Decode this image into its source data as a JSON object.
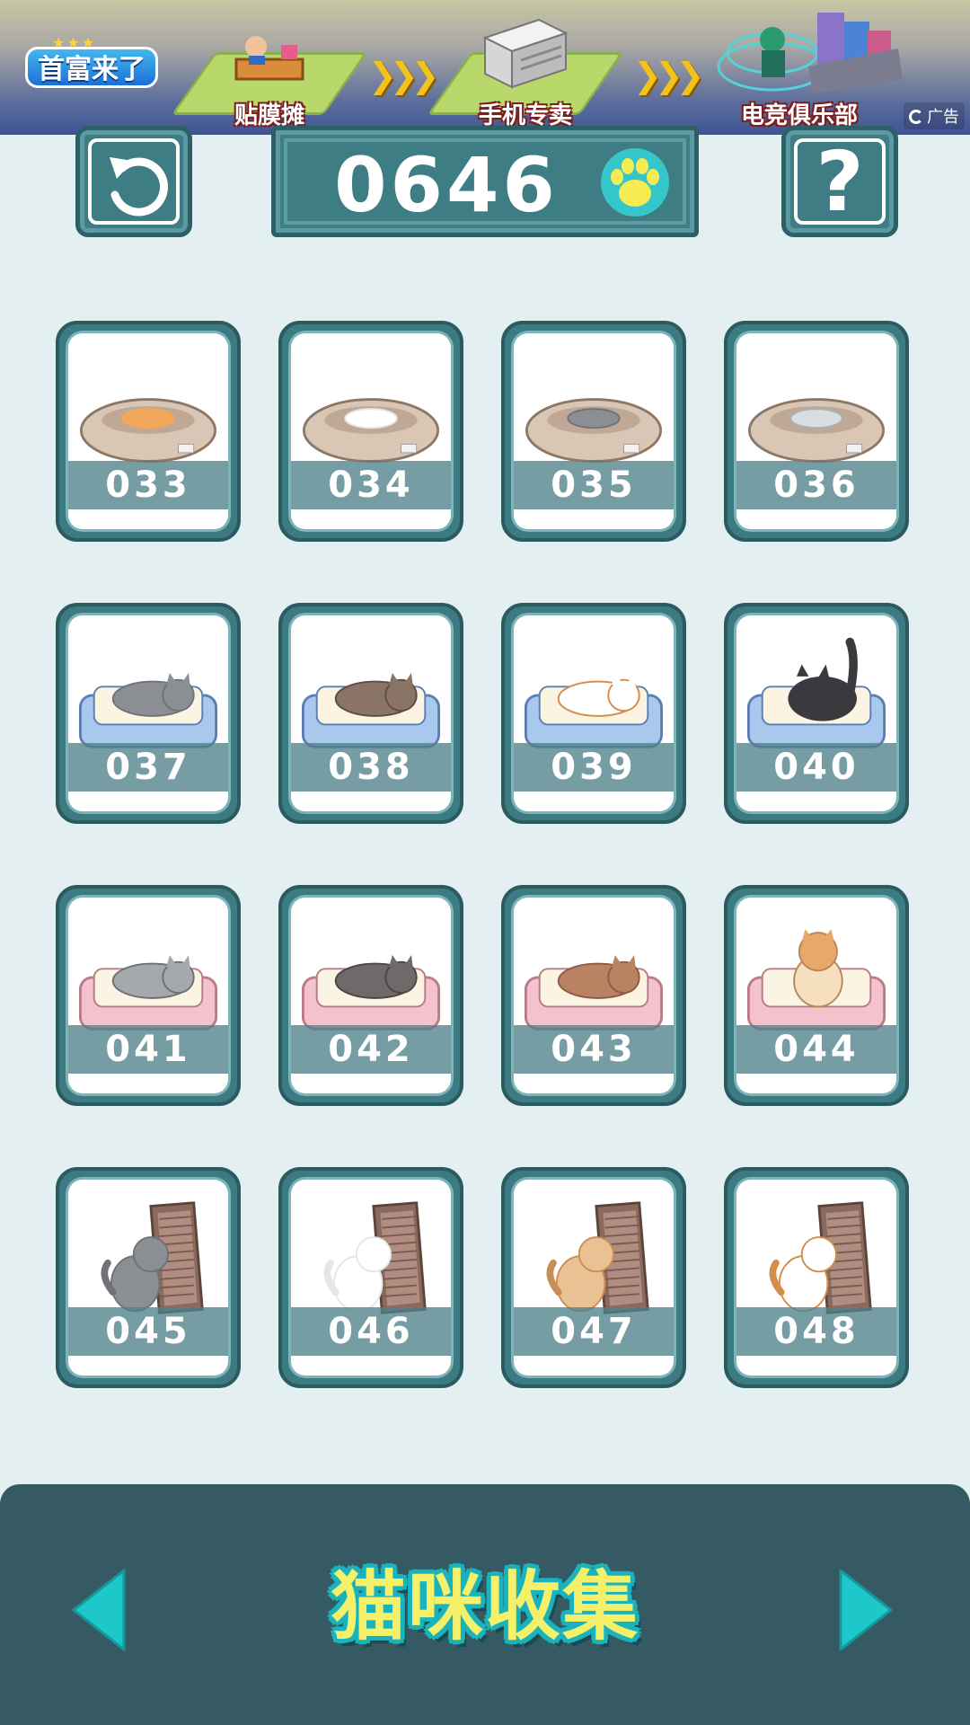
{
  "ad": {
    "logo_text": "首富来了",
    "items": [
      {
        "label": "贴膜摊"
      },
      {
        "label": "手机专卖"
      },
      {
        "label": "电竞俱乐部"
      }
    ],
    "tag": "广告"
  },
  "top": {
    "score": "0646",
    "help_label": "?"
  },
  "cards": [
    {
      "id": "033",
      "bed": "nest",
      "cat": "orange"
    },
    {
      "id": "034",
      "bed": "nest",
      "cat": "white"
    },
    {
      "id": "035",
      "bed": "nest",
      "cat": "gray"
    },
    {
      "id": "036",
      "bed": "nest",
      "cat": "silver-tabby"
    },
    {
      "id": "037",
      "bed": "blue",
      "cat": "gray"
    },
    {
      "id": "038",
      "bed": "blue",
      "cat": "brown-tabby"
    },
    {
      "id": "039",
      "bed": "blue",
      "cat": "calico"
    },
    {
      "id": "040",
      "bed": "blue",
      "cat": "black"
    },
    {
      "id": "041",
      "bed": "pink",
      "cat": "gray-tabby"
    },
    {
      "id": "042",
      "bed": "pink",
      "cat": "dark-tabby"
    },
    {
      "id": "043",
      "bed": "pink",
      "cat": "brown"
    },
    {
      "id": "044",
      "bed": "pink",
      "cat": "orange-white"
    },
    {
      "id": "045",
      "bed": "scratcher",
      "cat": "gray"
    },
    {
      "id": "046",
      "bed": "scratcher",
      "cat": "white"
    },
    {
      "id": "047",
      "bed": "scratcher",
      "cat": "orange-tabby"
    },
    {
      "id": "048",
      "bed": "scratcher",
      "cat": "calico"
    }
  ],
  "bottom": {
    "title": "猫咪收集"
  },
  "colors": {
    "background": "#e3eff0",
    "card_frame": "#3c7b82",
    "bottom_bar": "#365a63",
    "accent_cyan": "#19b3bd",
    "title_yellow": "#f4f06a"
  }
}
